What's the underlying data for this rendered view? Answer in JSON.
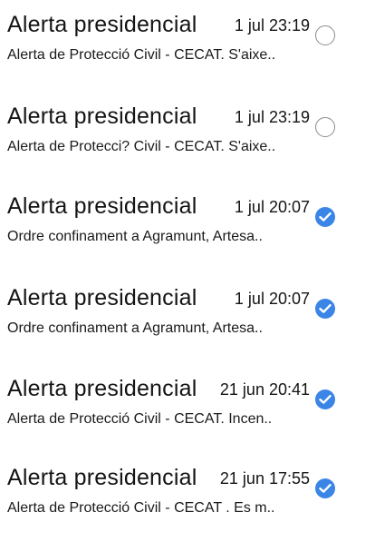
{
  "messages": [
    {
      "title": "Alerta presidencial",
      "date": "1 jul 23:19",
      "preview": "Alerta de Protecció Civil - CECAT. S'aixe..",
      "read": false
    },
    {
      "title": "Alerta presidencial",
      "date": "1 jul 23:19",
      "preview": "Alerta de Protecci? Civil - CECAT. S'aixe..",
      "read": false
    },
    {
      "title": "Alerta presidencial",
      "date": "1 jul 20:07",
      "preview": "Ordre confinament a Agramunt, Artesa..",
      "read": true
    },
    {
      "title": "Alerta presidencial",
      "date": "1 jul 20:07",
      "preview": "Ordre confinament a Agramunt, Artesa..",
      "read": true
    },
    {
      "title": "Alerta presidencial",
      "date": "21 jun 20:41",
      "preview": "Alerta de Protecció Civil - CECAT. Incen..",
      "read": true
    },
    {
      "title": "Alerta presidencial",
      "date": "21 jun 17:55",
      "preview": "Alerta de Protecció Civil - CECAT . Es m..",
      "read": true
    }
  ],
  "colors": {
    "read_check": "#3a85e6",
    "unread_ring": "#8a8a8a"
  },
  "icons": {
    "read": "check-circle-icon",
    "unread": "empty-circle-icon"
  }
}
